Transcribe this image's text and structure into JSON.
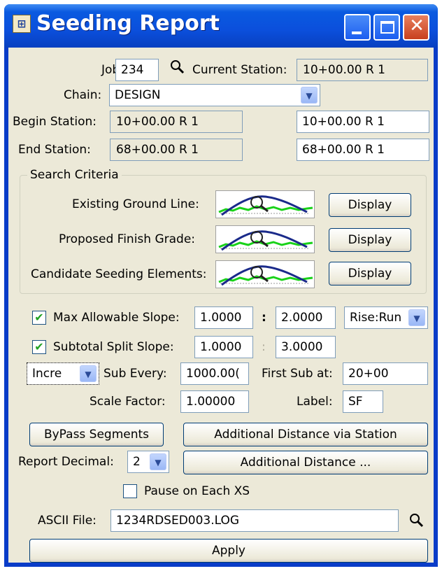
{
  "window": {
    "title": "Seeding Report",
    "title_icon": "app-icon",
    "caption_buttons": [
      "minimize",
      "maximize",
      "close"
    ]
  },
  "job": {
    "label": "Job:",
    "value": "234"
  },
  "current_station": {
    "label": "Current Station:",
    "value": "10+00.00 R 1"
  },
  "chain": {
    "label": "Chain:",
    "value": "DESIGN"
  },
  "begin_station": {
    "label": "Begin Station:",
    "value": "10+00.00 R 1",
    "input": "10+00.00 R 1"
  },
  "end_station": {
    "label": "End Station:",
    "value": "68+00.00 R 1",
    "input": "68+00.00 R 1"
  },
  "search_criteria": {
    "title": "Search Criteria",
    "rows": [
      {
        "label": "Existing Ground Line:",
        "button": "Display"
      },
      {
        "label": "Proposed Finish Grade:",
        "button": "Display"
      },
      {
        "label": "Candidate Seeding Elements:",
        "button": "Display"
      }
    ]
  },
  "max_slope": {
    "label": "Max Allowable Slope:",
    "checked": true,
    "rise": "1.0000",
    "sep": ":",
    "run": "2.0000",
    "mode": "Rise:Run"
  },
  "subtotal_slope": {
    "label": "Subtotal Split Slope:",
    "checked": true,
    "rise": "1.0000",
    "sep": ":",
    "run": "3.0000"
  },
  "increment": {
    "mode": "Incre",
    "sub_every_label": "Sub Every:",
    "sub_every": "1000.00(",
    "first_sub_label": "First Sub at:",
    "first_sub": "20+00"
  },
  "scale": {
    "label": "Scale Factor:",
    "value": "1.00000",
    "label_label": "Label:",
    "label_value": "SF"
  },
  "buttons": {
    "bypass": "ByPass Segments",
    "add_dist_station": "Additional Distance via Station",
    "add_dist": "Additional Distance ...",
    "apply": "Apply"
  },
  "report_decimal": {
    "label": "Report Decimal:",
    "value": "2"
  },
  "pause": {
    "label": "Pause on Each XS",
    "checked": false
  },
  "ascii_file": {
    "label": "ASCII File:",
    "value": "1234RDSED003.LOG"
  },
  "colors": {
    "titlebar": "#0b4fdc",
    "client": "#ece9d8",
    "close": "#c8401e",
    "check": "#21a121"
  }
}
